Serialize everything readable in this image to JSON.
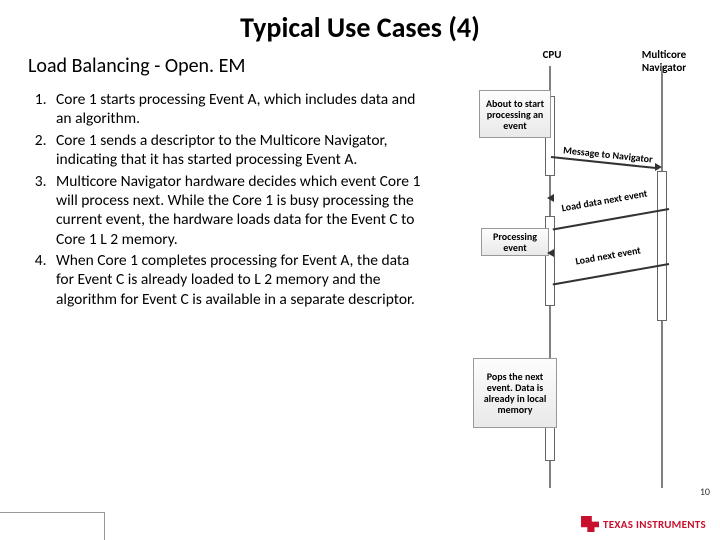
{
  "title": "Typical Use Cases (4)",
  "subtitle": "Load Balancing - Open. EM",
  "list": {
    "i1": "Core 1 starts processing Event A, which includes data and an algorithm.",
    "i2": "Core 1 sends a descriptor to the Multicore Navigator, indicating that it has started processing Event A.",
    "i3": "Multicore Navigator hardware decides which event Core 1 will process next. While the Core 1 is busy processing the current event, the hardware loads data for the Event C to Core 1 L 2 memory.",
    "i4": "When Core 1 completes processing for Event A, the data for Event C is already loaded to L 2 memory and the algorithm for Event C is available in a separate descriptor."
  },
  "diagram": {
    "hdr_cpu": "CPU",
    "hdr_nav": "Multicore Navigator",
    "node1": "About to start processing an event",
    "node2": "Processing event",
    "node3": "Pops the next event. Data is already in local memory",
    "arrow1": "Message to Navigator",
    "arrow2": "Load data next event",
    "arrow3": "Load next event"
  },
  "pagenum": "10",
  "logo_text": "TEXAS INSTRUMENTS"
}
